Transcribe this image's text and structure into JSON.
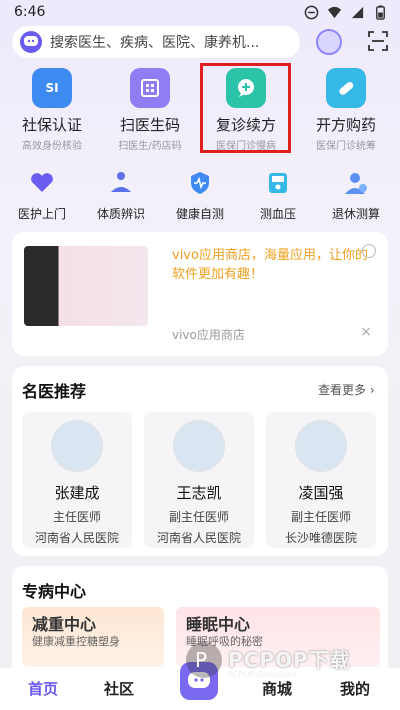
{
  "status_bar": {
    "time": "6:46"
  },
  "search": {
    "placeholder": "搜索医生、疾病、医院、康养机..."
  },
  "features": [
    {
      "title": "社保认证",
      "subtitle": "高效身份核验",
      "icon": "shield-id-icon",
      "color": "#3d8bf2",
      "badge": "SI"
    },
    {
      "title": "扫医生码",
      "subtitle": "扫医生/药店码",
      "icon": "qr-scan-icon",
      "color": "#8f7df4",
      "badge": ""
    },
    {
      "title": "复诊续方",
      "subtitle": "医保门诊慢病",
      "icon": "chat-plus-icon",
      "color": "#2cc4a8",
      "badge": ""
    },
    {
      "title": "开方购药",
      "subtitle": "医保门诊统筹",
      "icon": "pill-icon",
      "color": "#36b9e6",
      "badge": ""
    }
  ],
  "quick": [
    {
      "label": "医护上门",
      "icon": "heart-hands-icon"
    },
    {
      "label": "体质辨识",
      "icon": "meditation-icon"
    },
    {
      "label": "健康自测",
      "icon": "pulse-shield-icon"
    },
    {
      "label": "测血压",
      "icon": "bp-monitor-icon"
    },
    {
      "label": "退休测算",
      "icon": "retire-user-icon"
    }
  ],
  "ad": {
    "text": "vivo应用商店，海量应用，让你的软件更加有趣！",
    "source": "vivo应用商店",
    "close": "×"
  },
  "doctors_section": {
    "title": "名医推荐",
    "more": "查看更多",
    "doctors": [
      {
        "name": "张建成",
        "title": "主任医师",
        "hospital": "河南省人民医院"
      },
      {
        "name": "王志凯",
        "title": "副主任医师",
        "hospital": "河南省人民医院"
      },
      {
        "name": "凌国强",
        "title": "副主任医师",
        "hospital": "长沙唯德医院"
      }
    ]
  },
  "specialty": {
    "title": "专病中心",
    "cards": [
      {
        "title": "减重中心",
        "subtitle": "健康减重控糖塑身"
      },
      {
        "title": "睡眠中心",
        "subtitle": "睡眠呼吸的秘密"
      }
    ]
  },
  "watermark": {
    "text": "PCPOP下载",
    "sub": "PCPOP Download"
  },
  "tabbar": {
    "home": "首页",
    "community": "社区",
    "mall": "商城",
    "mine": "我的"
  },
  "colors": {
    "accent": "#6a5cf0",
    "highlight": "#e02020",
    "ad_text": "#f0a01e"
  }
}
